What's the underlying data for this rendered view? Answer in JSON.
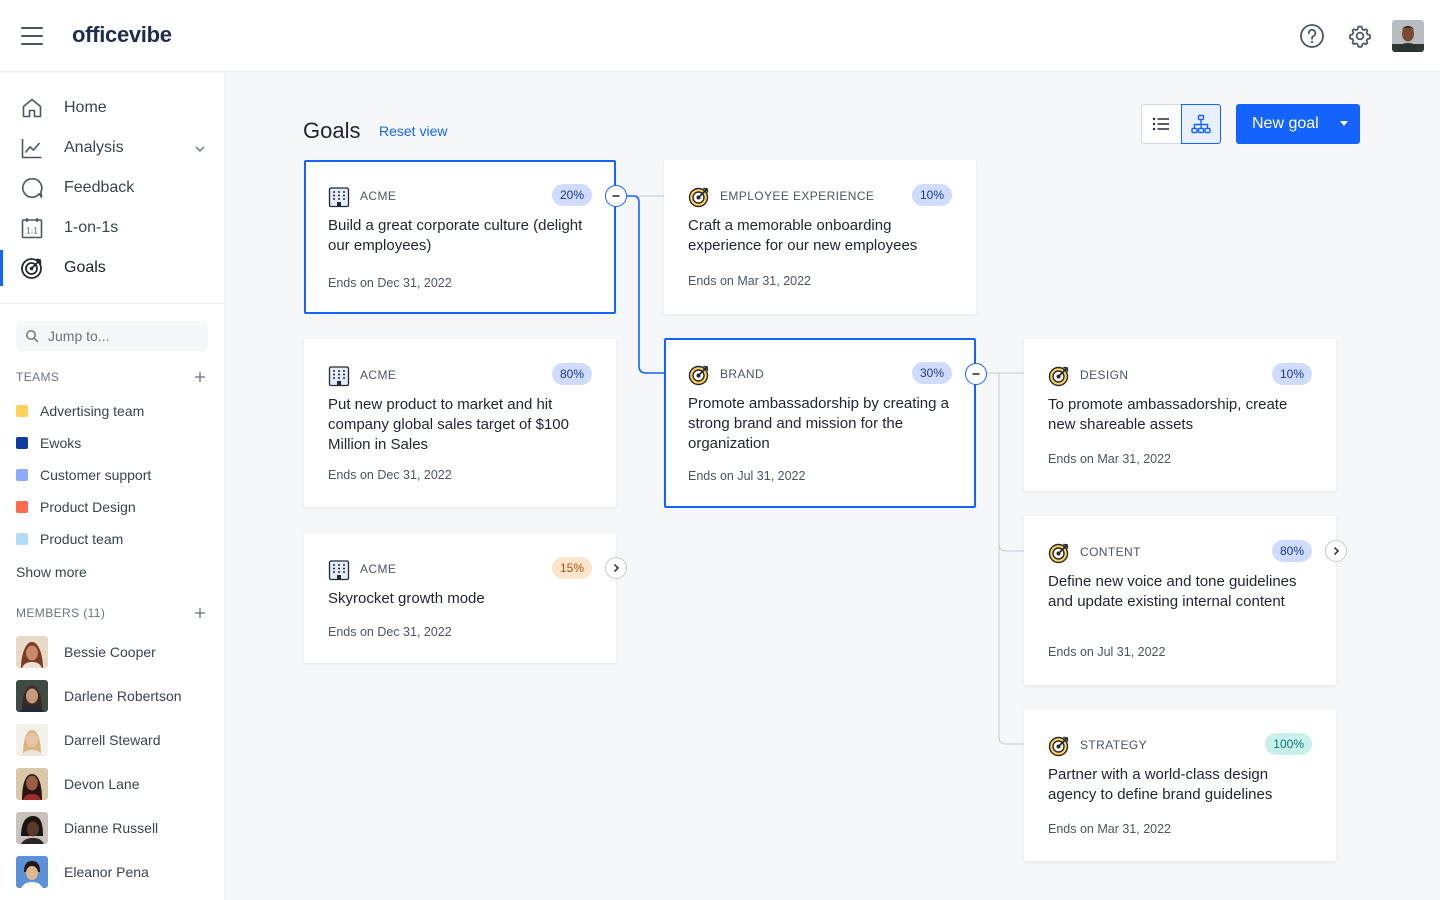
{
  "app": {
    "logo": "officevibe"
  },
  "colors": {
    "accent": "#1563ff",
    "badge_blue": "#cfdcff",
    "badge_orange": "#fde4cc",
    "badge_teal": "#c9f1ec"
  },
  "nav": {
    "items": [
      {
        "label": "Home",
        "icon": "home-icon"
      },
      {
        "label": "Analysis",
        "icon": "chart-line-icon"
      },
      {
        "label": "Feedback",
        "icon": "chat-bubble-icon"
      },
      {
        "label": "1-on-1s",
        "icon": "calendar-icon"
      },
      {
        "label": "Goals",
        "icon": "target-icon"
      }
    ]
  },
  "sidebar": {
    "jump_placeholder": "Jump to...",
    "teams_heading": "TEAMS",
    "teams": [
      {
        "name": "Advertising team",
        "color": "#ffd25f"
      },
      {
        "name": "Ewoks",
        "color": "#0e3a9e"
      },
      {
        "name": "Customer support",
        "color": "#8fa9ff"
      },
      {
        "name": "Product Design",
        "color": "#ff6a4d"
      },
      {
        "name": "Product team",
        "color": "#b5dcf7"
      }
    ],
    "show_more": "Show more",
    "members_heading": "MEMBERS (11)",
    "members": [
      {
        "name": "Bessie Cooper",
        "skin": "#c98a6a",
        "hair": "#7a3b22"
      },
      {
        "name": "Darlene Robertson",
        "skin": "#c79a7c",
        "hair": "#3a2a22"
      },
      {
        "name": "Darrell Steward",
        "skin": "#e7c6a7",
        "hair": "#d8b57c"
      },
      {
        "name": "Devon Lane",
        "skin": "#9b5e43",
        "hair": "#2a1712"
      },
      {
        "name": "Dianne Russell",
        "skin": "#5c3a2b",
        "hair": "#1c1410"
      },
      {
        "name": "Eleanor Pena",
        "skin": "#e0b592",
        "hair": "#1f1a18"
      }
    ]
  },
  "main": {
    "title": "Goals",
    "reset_view": "Reset view",
    "new_goal": "New goal"
  },
  "goals": {
    "g1": {
      "category": "ACME",
      "percent": "20%",
      "title": "Build a great corporate culture (delight our employees)",
      "ends": "Ends on Dec 31, 2022"
    },
    "g2": {
      "category": "ACME",
      "percent": "80%",
      "title": "Put new product to market and hit company global sales target of $100 Million in Sales",
      "ends": "Ends on Dec 31, 2022"
    },
    "g3": {
      "category": "ACME",
      "percent": "15%",
      "title": "Skyrocket growth mode",
      "ends": "Ends on Dec 31, 2022"
    },
    "g4": {
      "category": "EMPLOYEE EXPERIENCE",
      "percent": "10%",
      "title": "Craft a memorable onboarding experience for our new employees",
      "ends": "Ends on Mar 31, 2022"
    },
    "g5": {
      "category": "BRAND",
      "percent": "30%",
      "title": "Promote ambassadorship by creating a strong brand and mission for the organization",
      "ends": "Ends on Jul 31, 2022"
    },
    "g6": {
      "category": "DESIGN",
      "percent": "10%",
      "title": "To promote ambassadorship, create new shareable assets",
      "ends": "Ends on Mar 31, 2022"
    },
    "g7": {
      "category": "CONTENT",
      "percent": "80%",
      "title": "Define new voice and tone guidelines and update existing internal content",
      "ends": "Ends on Jul 31, 2022"
    },
    "g8": {
      "category": "STRATEGY",
      "percent": "100%",
      "title": "Partner with a world-class design agency to define brand guidelines",
      "ends": "Ends on Mar 31, 2022"
    }
  }
}
